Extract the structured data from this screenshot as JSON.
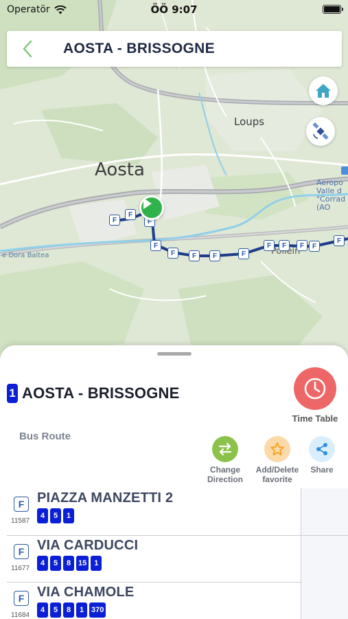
{
  "status_bar": {
    "carrier": "Operatör",
    "time": "ÖÖ 9:07"
  },
  "header": {
    "title": "AOSTA - BRISSOGNE",
    "back_icon": "chevron-left-icon"
  },
  "map": {
    "labels": {
      "aosta": "Aosta",
      "loups": "Loups",
      "pollein": "Pollein",
      "airport_1": "Aeropo",
      "airport_2": "Valle d",
      "airport_3": "\"Corrad",
      "airport_4": "(AO",
      "river": "e Dora Baltea"
    },
    "stop_marker": "F",
    "colors": {
      "route": "#1d3c8a",
      "start": "#2fb34a",
      "river": "#8fd0ea"
    }
  },
  "sheet": {
    "route_number": "1",
    "route_title": "AOSTA - BRISSOGNE",
    "timetable_label": "Time Table",
    "bus_route_label": "Bus Route",
    "actions": {
      "change_direction": "Change\nDirection",
      "favorite": "Add/Delete\nfavorite",
      "share": "Share"
    },
    "stops": [
      {
        "icon": "F",
        "code": "11587",
        "name": "PIAZZA MANZETTI 2",
        "lines": [
          "4",
          "5",
          "1"
        ]
      },
      {
        "icon": "F",
        "code": "11677",
        "name": "VIA CARDUCCI",
        "lines": [
          "4",
          "5",
          "8",
          "15",
          "1"
        ]
      },
      {
        "icon": "F",
        "code": "11684",
        "name": "VIA CHAMOLE",
        "lines": [
          "4",
          "5",
          "8",
          "1",
          "370"
        ]
      }
    ],
    "colors": {
      "accent_green": "#8bc34a",
      "route_badge": "#0a1fd6",
      "timetable": "#ee6768"
    }
  }
}
